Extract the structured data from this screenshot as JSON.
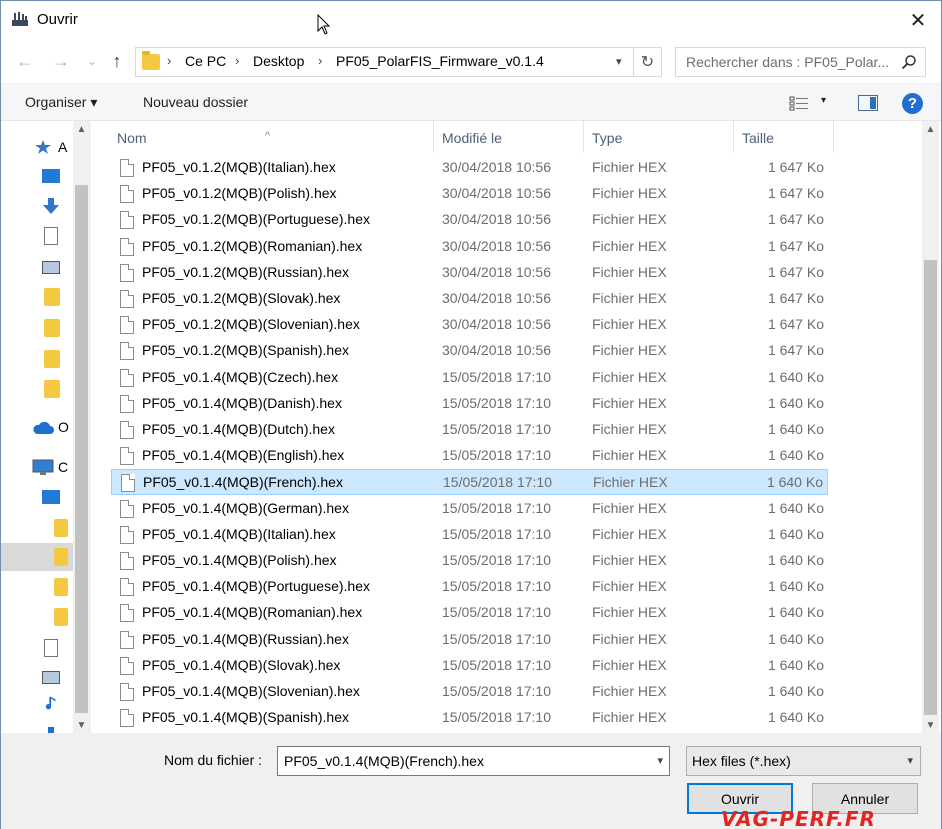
{
  "window": {
    "title": "Ouvrir",
    "close_glyph": "✕"
  },
  "navigation": {
    "back_glyph": "←",
    "forward_glyph": "→",
    "recent_glyph": "⌄",
    "up_glyph": "↑",
    "breadcrumbs": [
      "Ce PC",
      "Desktop",
      "PF05_PolarFIS_Firmware_v0.1.4"
    ],
    "separator": "›",
    "refresh_glyph": "↻",
    "search_placeholder": "Rechercher dans : PF05_Polar..."
  },
  "toolbar": {
    "organize_label": "Organiser ▾",
    "new_folder_label": "Nouveau dossier",
    "help_glyph": "?"
  },
  "nav_pane": {
    "labels": [
      "A",
      "O",
      "C"
    ]
  },
  "columns": {
    "name": "Nom",
    "modified": "Modifié le",
    "type": "Type",
    "size": "Taille"
  },
  "files": [
    {
      "name": "PF05_v0.1.2(MQB)(Italian).hex",
      "date": "30/04/2018 10:56",
      "type": "Fichier HEX",
      "size": "1 647 Ko"
    },
    {
      "name": "PF05_v0.1.2(MQB)(Polish).hex",
      "date": "30/04/2018 10:56",
      "type": "Fichier HEX",
      "size": "1 647 Ko"
    },
    {
      "name": "PF05_v0.1.2(MQB)(Portuguese).hex",
      "date": "30/04/2018 10:56",
      "type": "Fichier HEX",
      "size": "1 647 Ko"
    },
    {
      "name": "PF05_v0.1.2(MQB)(Romanian).hex",
      "date": "30/04/2018 10:56",
      "type": "Fichier HEX",
      "size": "1 647 Ko"
    },
    {
      "name": "PF05_v0.1.2(MQB)(Russian).hex",
      "date": "30/04/2018 10:56",
      "type": "Fichier HEX",
      "size": "1 647 Ko"
    },
    {
      "name": "PF05_v0.1.2(MQB)(Slovak).hex",
      "date": "30/04/2018 10:56",
      "type": "Fichier HEX",
      "size": "1 647 Ko"
    },
    {
      "name": "PF05_v0.1.2(MQB)(Slovenian).hex",
      "date": "30/04/2018 10:56",
      "type": "Fichier HEX",
      "size": "1 647 Ko"
    },
    {
      "name": "PF05_v0.1.2(MQB)(Spanish).hex",
      "date": "30/04/2018 10:56",
      "type": "Fichier HEX",
      "size": "1 647 Ko"
    },
    {
      "name": "PF05_v0.1.4(MQB)(Czech).hex",
      "date": "15/05/2018 17:10",
      "type": "Fichier HEX",
      "size": "1 640 Ko"
    },
    {
      "name": "PF05_v0.1.4(MQB)(Danish).hex",
      "date": "15/05/2018 17:10",
      "type": "Fichier HEX",
      "size": "1 640 Ko"
    },
    {
      "name": "PF05_v0.1.4(MQB)(Dutch).hex",
      "date": "15/05/2018 17:10",
      "type": "Fichier HEX",
      "size": "1 640 Ko"
    },
    {
      "name": "PF05_v0.1.4(MQB)(English).hex",
      "date": "15/05/2018 17:10",
      "type": "Fichier HEX",
      "size": "1 640 Ko"
    },
    {
      "name": "PF05_v0.1.4(MQB)(French).hex",
      "date": "15/05/2018 17:10",
      "type": "Fichier HEX",
      "size": "1 640 Ko",
      "selected": true
    },
    {
      "name": "PF05_v0.1.4(MQB)(German).hex",
      "date": "15/05/2018 17:10",
      "type": "Fichier HEX",
      "size": "1 640 Ko"
    },
    {
      "name": "PF05_v0.1.4(MQB)(Italian).hex",
      "date": "15/05/2018 17:10",
      "type": "Fichier HEX",
      "size": "1 640 Ko"
    },
    {
      "name": "PF05_v0.1.4(MQB)(Polish).hex",
      "date": "15/05/2018 17:10",
      "type": "Fichier HEX",
      "size": "1 640 Ko"
    },
    {
      "name": "PF05_v0.1.4(MQB)(Portuguese).hex",
      "date": "15/05/2018 17:10",
      "type": "Fichier HEX",
      "size": "1 640 Ko"
    },
    {
      "name": "PF05_v0.1.4(MQB)(Romanian).hex",
      "date": "15/05/2018 17:10",
      "type": "Fichier HEX",
      "size": "1 640 Ko"
    },
    {
      "name": "PF05_v0.1.4(MQB)(Russian).hex",
      "date": "15/05/2018 17:10",
      "type": "Fichier HEX",
      "size": "1 640 Ko"
    },
    {
      "name": "PF05_v0.1.4(MQB)(Slovak).hex",
      "date": "15/05/2018 17:10",
      "type": "Fichier HEX",
      "size": "1 640 Ko"
    },
    {
      "name": "PF05_v0.1.4(MQB)(Slovenian).hex",
      "date": "15/05/2018 17:10",
      "type": "Fichier HEX",
      "size": "1 640 Ko"
    },
    {
      "name": "PF05_v0.1.4(MQB)(Spanish).hex",
      "date": "15/05/2018 17:10",
      "type": "Fichier HEX",
      "size": "1 640 Ko"
    }
  ],
  "footer": {
    "filename_label": "Nom du fichier :",
    "filename_value": "PF05_v0.1.4(MQB)(French).hex",
    "filter_value": "Hex files (*.hex)",
    "open_label": "Ouvrir",
    "cancel_label": "Annuler",
    "dropdown_glyph": "▾"
  },
  "watermark": "VAG-PERF.FR",
  "colors": {
    "selection_bg": "#cce8ff",
    "selection_border": "#99d1ff",
    "primary_button_border": "#0078d7",
    "watermark": "#e52421"
  }
}
